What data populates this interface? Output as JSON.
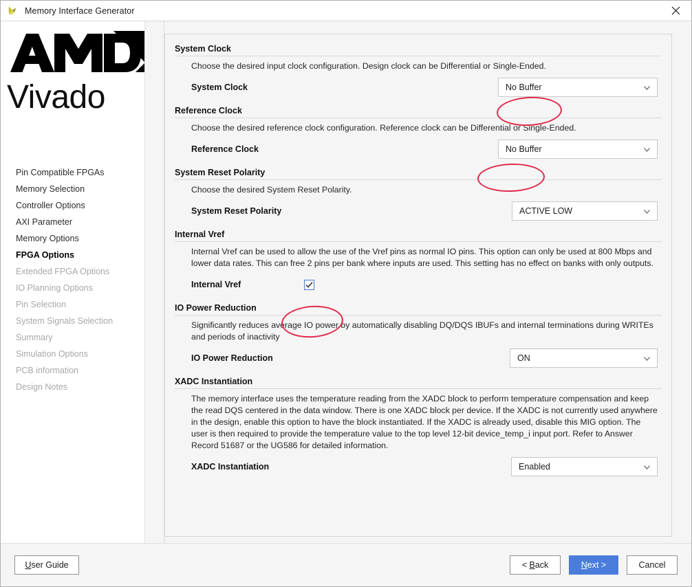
{
  "window": {
    "title": "Memory Interface Generator",
    "app_icon": "vivado-logo-icon",
    "close_icon": "close-icon"
  },
  "branding": {
    "logo": "AMD",
    "product": "Vivado"
  },
  "sidebar": {
    "items": [
      {
        "label": "Pin Compatible FPGAs",
        "state": "done"
      },
      {
        "label": "Memory Selection",
        "state": "done"
      },
      {
        "label": "Controller Options",
        "state": "done"
      },
      {
        "label": "AXI Parameter",
        "state": "done"
      },
      {
        "label": "Memory Options",
        "state": "done"
      },
      {
        "label": "FPGA Options",
        "state": "current"
      },
      {
        "label": "Extended FPGA Options",
        "state": "disabled"
      },
      {
        "label": "IO Planning Options",
        "state": "disabled"
      },
      {
        "label": "Pin Selection",
        "state": "disabled"
      },
      {
        "label": "System Signals Selection",
        "state": "disabled"
      },
      {
        "label": "Summary",
        "state": "disabled"
      },
      {
        "label": "Simulation Options",
        "state": "disabled"
      },
      {
        "label": "PCB information",
        "state": "disabled"
      },
      {
        "label": "Design Notes",
        "state": "disabled"
      }
    ]
  },
  "sections": {
    "system_clock": {
      "heading": "System Clock",
      "description": "Choose the desired input clock configuration. Design clock can be Differential or Single-Ended.",
      "field_label": "System Clock",
      "value": "No Buffer"
    },
    "reference_clock": {
      "heading": "Reference Clock",
      "description": "Choose the desired reference clock configuration. Reference clock can be Differential or Single-Ended.",
      "field_label": "Reference Clock",
      "value": "No Buffer"
    },
    "system_reset_polarity": {
      "heading": "System Reset Polarity",
      "description": "Choose the desired System Reset Polarity.",
      "field_label": "System Reset Polarity",
      "value": "ACTIVE LOW"
    },
    "internal_vref": {
      "heading": "Internal Vref",
      "description": "Internal Vref can be used to allow the use of the Vref pins as normal IO pins. This option can only be used at 800 Mbps and lower data rates. This can free 2 pins per bank where inputs are used. This setting has no effect on banks with only outputs.",
      "field_label": "Internal Vref",
      "checked": true
    },
    "io_power_reduction": {
      "heading": "IO Power Reduction",
      "description": "Significantly reduces average IO power by automatically disabling DQ/DQS IBUFs and internal terminations during WRITEs and periods of inactivity",
      "field_label": "IO Power Reduction",
      "value": "ON"
    },
    "xadc_instantiation": {
      "heading": "XADC Instantiation",
      "description": "The memory interface uses the temperature reading from the XADC block to perform temperature compensation and keep the read DQS centered in the data window. There is one XADC block per device. If the XADC is not currently used anywhere in the design, enable this option to have the block instantiated. If the XADC is already used, disable this MIG option. The user is then required to provide the temperature value to the top level 12-bit device_temp_i input port. Refer to Answer Record 51687 or the UG586 for detailed information.",
      "field_label": "XADC Instantiation",
      "value": "Enabled"
    }
  },
  "footer": {
    "user_guide": "User Guide",
    "back": "< Back",
    "next": "Next >",
    "cancel": "Cancel"
  },
  "annotations": {
    "color": "#e02a4a",
    "marks": [
      {
        "target": "system-clock-combo"
      },
      {
        "target": "reference-clock-combo"
      },
      {
        "target": "internal-vref-checkbox"
      }
    ]
  },
  "colors": {
    "accent_button": "#4a7ddb",
    "annotation": "#e02a4a",
    "checkbox_border": "#4a79c8",
    "panel_bg": "#f5f5f5"
  }
}
